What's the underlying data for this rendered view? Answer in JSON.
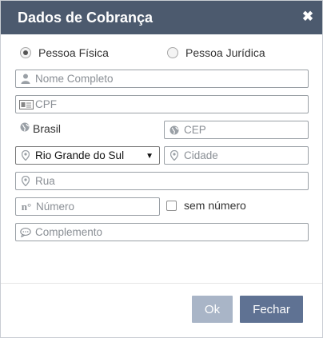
{
  "dialog": {
    "title": "Dados de Cobrança",
    "close_glyph": "✖"
  },
  "person_type": {
    "options": [
      {
        "label": "Pessoa Física",
        "selected": true
      },
      {
        "label": "Pessoa Jurídica",
        "selected": false
      }
    ]
  },
  "fields": {
    "nome": {
      "placeholder": "Nome Completo",
      "icon": "user-icon"
    },
    "cpf": {
      "placeholder": "CPF",
      "icon": "id-card-icon"
    },
    "pais": {
      "value": "Brasil",
      "icon": "globe-icon"
    },
    "cep": {
      "placeholder": "CEP",
      "icon": "globe-icon"
    },
    "estado": {
      "value": "Rio Grande do Sul",
      "icon": "map-pin-icon",
      "caret": "▼"
    },
    "cidade": {
      "placeholder": "Cidade",
      "icon": "map-pin-icon"
    },
    "rua": {
      "placeholder": "Rua",
      "icon": "map-pin-icon"
    },
    "numero": {
      "placeholder": "Número",
      "icon_text": "n°"
    },
    "sem_numero": {
      "label": "sem número",
      "checked": false
    },
    "complemento": {
      "placeholder": "Complemento",
      "icon": "speech-bubble-icon"
    }
  },
  "buttons": {
    "ok": "Ok",
    "close": "Fechar"
  },
  "colors": {
    "titlebar": "#4c5a6e",
    "ok_button": "#a9b5c7",
    "close_button": "#5f7293"
  }
}
